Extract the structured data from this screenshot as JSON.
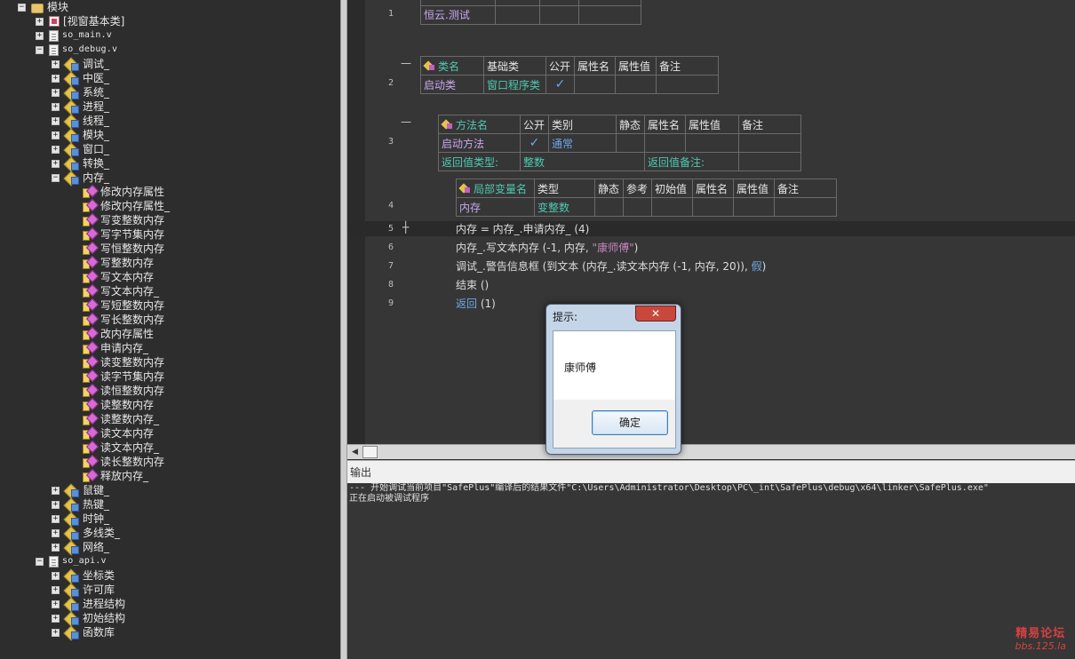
{
  "tree": [
    {
      "label": "模块",
      "level": 0,
      "expander": "−",
      "icon": "folder-icon",
      "mono": false
    },
    {
      "label": "[视窗基本类]",
      "level": 1,
      "expander": "+",
      "icon": "window-class-icon",
      "mono": false
    },
    {
      "label": "so_main.v",
      "level": 1,
      "expander": "+",
      "icon": "file-icon",
      "mono": true
    },
    {
      "label": "so_debug.v",
      "level": 1,
      "expander": "−",
      "icon": "file-icon",
      "mono": true
    },
    {
      "label": "调试_",
      "level": 2,
      "expander": "+",
      "icon": "module-icon",
      "mono": false
    },
    {
      "label": "中医_",
      "level": 2,
      "expander": "+",
      "icon": "module-icon",
      "mono": false
    },
    {
      "label": "系统_",
      "level": 2,
      "expander": "+",
      "icon": "module-icon",
      "mono": false
    },
    {
      "label": "进程_",
      "level": 2,
      "expander": "+",
      "icon": "module-icon",
      "mono": false
    },
    {
      "label": "线程_",
      "level": 2,
      "expander": "+",
      "icon": "module-icon",
      "mono": false
    },
    {
      "label": "模块_",
      "level": 2,
      "expander": "+",
      "icon": "module-icon",
      "mono": false
    },
    {
      "label": "窗口_",
      "level": 2,
      "expander": "+",
      "icon": "module-icon",
      "mono": false
    },
    {
      "label": "转换_",
      "level": 2,
      "expander": "+",
      "icon": "module-icon",
      "mono": false
    },
    {
      "label": "内存_",
      "level": 2,
      "expander": "−",
      "icon": "module-icon",
      "mono": false
    },
    {
      "label": "修改内存属性",
      "level": 3,
      "expander": "",
      "icon": "method-icon",
      "mono": false
    },
    {
      "label": "修改内存属性_",
      "level": 3,
      "expander": "",
      "icon": "method-icon",
      "mono": false
    },
    {
      "label": "写变整数内存",
      "level": 3,
      "expander": "",
      "icon": "method-icon",
      "mono": false
    },
    {
      "label": "写字节集内存",
      "level": 3,
      "expander": "",
      "icon": "method-icon",
      "mono": false
    },
    {
      "label": "写恒整数内存",
      "level": 3,
      "expander": "",
      "icon": "method-icon",
      "mono": false
    },
    {
      "label": "写整数内存",
      "level": 3,
      "expander": "",
      "icon": "method-icon",
      "mono": false
    },
    {
      "label": "写文本内存",
      "level": 3,
      "expander": "",
      "icon": "method-icon",
      "mono": false
    },
    {
      "label": "写文本内存_",
      "level": 3,
      "expander": "",
      "icon": "method-icon",
      "mono": false
    },
    {
      "label": "写短整数内存",
      "level": 3,
      "expander": "",
      "icon": "method-icon",
      "mono": false
    },
    {
      "label": "写长整数内存",
      "level": 3,
      "expander": "",
      "icon": "method-icon",
      "mono": false
    },
    {
      "label": "改内存属性",
      "level": 3,
      "expander": "",
      "icon": "method-icon",
      "mono": false
    },
    {
      "label": "申请内存_",
      "level": 3,
      "expander": "",
      "icon": "method-icon",
      "mono": false
    },
    {
      "label": "读变整数内存",
      "level": 3,
      "expander": "",
      "icon": "method-icon",
      "mono": false
    },
    {
      "label": "读字节集内存",
      "level": 3,
      "expander": "",
      "icon": "method-icon",
      "mono": false
    },
    {
      "label": "读恒整数内存",
      "level": 3,
      "expander": "",
      "icon": "method-icon",
      "mono": false
    },
    {
      "label": "读整数内存",
      "level": 3,
      "expander": "",
      "icon": "method-icon",
      "mono": false
    },
    {
      "label": "读整数内存_",
      "level": 3,
      "expander": "",
      "icon": "method-icon",
      "mono": false
    },
    {
      "label": "读文本内存",
      "level": 3,
      "expander": "",
      "icon": "method-icon",
      "mono": false
    },
    {
      "label": "读文本内存_",
      "level": 3,
      "expander": "",
      "icon": "method-icon",
      "mono": false
    },
    {
      "label": "读长整数内存",
      "level": 3,
      "expander": "",
      "icon": "method-icon",
      "mono": false
    },
    {
      "label": "释放内存_",
      "level": 3,
      "expander": "",
      "icon": "method-icon",
      "mono": false
    },
    {
      "label": "鼠键_",
      "level": 2,
      "expander": "+",
      "icon": "module-icon",
      "mono": false
    },
    {
      "label": "热键_",
      "level": 2,
      "expander": "+",
      "icon": "module-icon",
      "mono": false
    },
    {
      "label": "时钟_",
      "level": 2,
      "expander": "+",
      "icon": "module-icon",
      "mono": false
    },
    {
      "label": "多线类_",
      "level": 2,
      "expander": "+",
      "icon": "module-icon",
      "mono": false
    },
    {
      "label": "网络_",
      "level": 2,
      "expander": "+",
      "icon": "module-icon",
      "mono": false
    },
    {
      "label": "so_api.v",
      "level": 1,
      "expander": "−",
      "icon": "file-icon",
      "mono": true
    },
    {
      "label": "坐标类",
      "level": 2,
      "expander": "+",
      "icon": "module-icon",
      "mono": false
    },
    {
      "label": "许可库",
      "level": 2,
      "expander": "+",
      "icon": "module-icon",
      "mono": false
    },
    {
      "label": "进程结构",
      "level": 2,
      "expander": "+",
      "icon": "module-icon",
      "mono": false
    },
    {
      "label": "初始结构",
      "level": 2,
      "expander": "+",
      "icon": "module-icon",
      "mono": false
    },
    {
      "label": "函数库",
      "level": 2,
      "expander": "+",
      "icon": "module-icon",
      "mono": false
    }
  ],
  "editor": {
    "line_numbers": [
      "1",
      "2",
      "3",
      "4",
      "5",
      "6",
      "7",
      "8",
      "9"
    ],
    "line1": {
      "value": "恒云.测试"
    },
    "class_table": {
      "headers": [
        "类名",
        "基础类",
        "公开",
        "属性名",
        "属性值",
        "备注"
      ],
      "row": [
        "启动类",
        "窗口程序类",
        "✓",
        "",
        "",
        ""
      ]
    },
    "method_table": {
      "headers": [
        "方法名",
        "公开",
        "类别",
        "静态",
        "属性名",
        "属性值",
        "备注"
      ],
      "row": [
        "启动方法",
        "✓",
        "通常",
        "",
        "",
        "",
        ""
      ],
      "return_type_label": "返回值类型:",
      "return_type_value": "整数",
      "return_note_label": "返回值备注:"
    },
    "local_table": {
      "headers": [
        "局部变量名",
        "类型",
        "静态",
        "参考",
        "初始值",
        "属性名",
        "属性值",
        "备注"
      ],
      "row": [
        "内存",
        "变整数",
        "",
        "",
        "",
        "",
        "",
        ""
      ]
    },
    "code": {
      "l5": "内存 = 内存_.申请内存_ (4)",
      "l6_a": "内存_.写文本内存 (-1, 内存, ",
      "l6_str": "\"康师傅\"",
      "l6_b": ")",
      "l7_a": "调试_.警告信息框 (到文本 (内存_.读文本内存 (-1, 内存, 20)), ",
      "l7_kw": "假",
      "l7_b": ")",
      "l8": "结束 ()",
      "l9_kw": "返回",
      "l9_b": " (1)"
    }
  },
  "output": {
    "title": "输出",
    "lines": [
      "--- 开始调试当前项目\"SafePlus\"编译后的结果文件\"C:\\Users\\Administrator\\Desktop\\PC\\_int\\SafePlus\\debug\\x64\\linker\\SafePlus.exe\"",
      "正在启动被调试程序"
    ]
  },
  "dialog": {
    "title": "提示:",
    "close_label": "✕",
    "message": "康师傅",
    "ok_label": "确定"
  },
  "watermark": {
    "line1": "精易论坛",
    "line2": "bbs.125.la"
  },
  "colors": {
    "accent_blue": "#6ea8e6",
    "accent_green": "#4ec9b0",
    "string_purple": "#c586c0",
    "close_red": "#c9483e"
  }
}
